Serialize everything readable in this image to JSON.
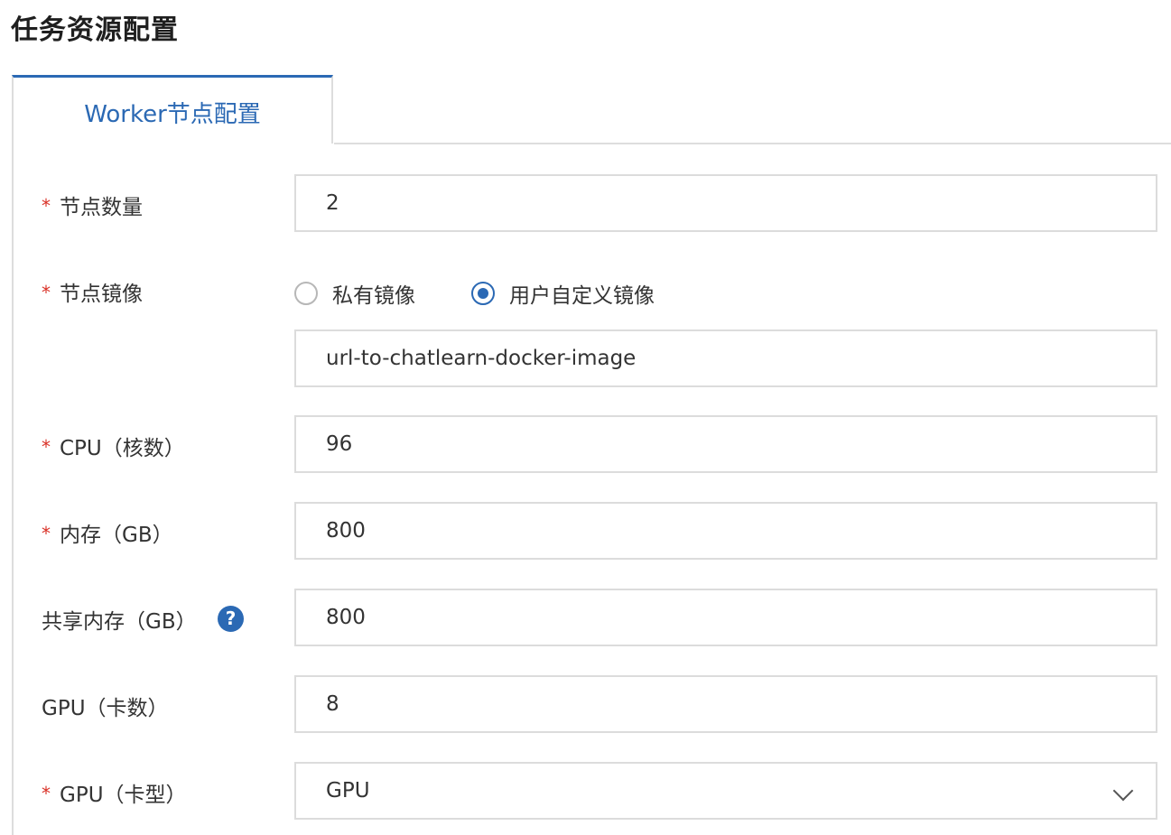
{
  "page": {
    "title": "任务资源配置"
  },
  "tabs": [
    {
      "label": "Worker节点配置",
      "active": true
    }
  ],
  "form": {
    "node_count": {
      "label": "节点数量",
      "required": true,
      "value": "2"
    },
    "node_image": {
      "label": "节点镜像",
      "required": true,
      "options": [
        {
          "label": "私有镜像",
          "selected": false
        },
        {
          "label": "用户自定义镜像",
          "selected": true
        }
      ],
      "image_url": "url-to-chatlearn-docker-image"
    },
    "cpu": {
      "label": "CPU（核数）",
      "required": true,
      "value": "96"
    },
    "memory": {
      "label": "内存（GB）",
      "required": true,
      "value": "800"
    },
    "shared_memory": {
      "label": "共享内存（GB）",
      "required": false,
      "value": "800",
      "help_icon": "question-circle-icon"
    },
    "gpu_count": {
      "label": "GPU（卡数）",
      "required": false,
      "value": "8"
    },
    "gpu_type": {
      "label": "GPU（卡型）",
      "required": true,
      "value": "GPU",
      "icon": "chevron-down-icon"
    }
  },
  "colors": {
    "accent": "#2b69b4",
    "required": "#d93026",
    "border": "#dcdcdc"
  }
}
